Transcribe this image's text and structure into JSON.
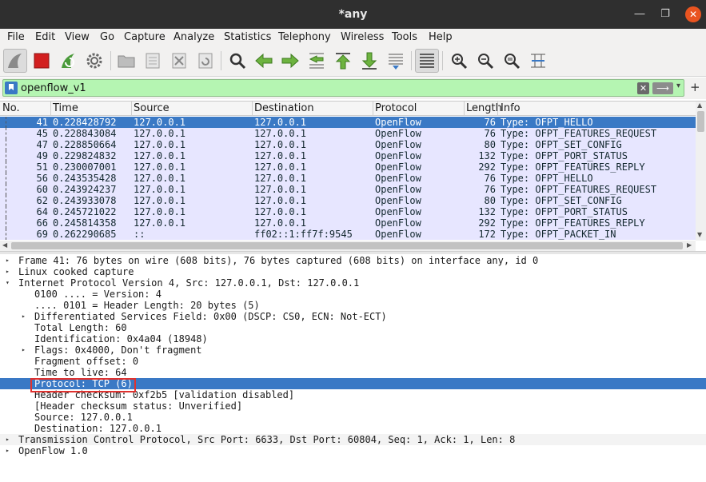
{
  "window": {
    "title": "*any"
  },
  "menu": [
    "File",
    "Edit",
    "View",
    "Go",
    "Capture",
    "Analyze",
    "Statistics",
    "Telephony",
    "Wireless",
    "Tools",
    "Help"
  ],
  "toolbar_icons": [
    "shark-fin-icon",
    "stop-icon",
    "restart-icon",
    "options-gear-icon",
    "open-folder-icon",
    "save-file-icon",
    "close-file-icon",
    "reload-file-icon",
    "find-icon",
    "back-arrow-icon",
    "forward-arrow-icon",
    "goto-packet-icon",
    "first-packet-icon",
    "last-packet-icon",
    "autoscroll-icon",
    "colorize-icon",
    "zoom-in-icon",
    "zoom-out-icon",
    "zoom-normal-icon",
    "resize-columns-icon"
  ],
  "filter": {
    "value": "openflow_v1",
    "clear": "✕",
    "apply": "⟶",
    "dropdown": "▾",
    "add": "+"
  },
  "packet_list": {
    "columns": [
      "No.",
      "Time",
      "Source",
      "Destination",
      "Protocol",
      "Length",
      "Info"
    ],
    "rows": [
      [
        "41",
        "0.228428792",
        "127.0.0.1",
        "127.0.0.1",
        "OpenFlow",
        "76",
        "Type: OFPT_HELLO"
      ],
      [
        "45",
        "0.228843084",
        "127.0.0.1",
        "127.0.0.1",
        "OpenFlow",
        "76",
        "Type: OFPT_FEATURES_REQUEST"
      ],
      [
        "47",
        "0.228850664",
        "127.0.0.1",
        "127.0.0.1",
        "OpenFlow",
        "80",
        "Type: OFPT_SET_CONFIG"
      ],
      [
        "49",
        "0.229824832",
        "127.0.0.1",
        "127.0.0.1",
        "OpenFlow",
        "132",
        "Type: OFPT_PORT_STATUS"
      ],
      [
        "51",
        "0.230007001",
        "127.0.0.1",
        "127.0.0.1",
        "OpenFlow",
        "292",
        "Type: OFPT_FEATURES_REPLY"
      ],
      [
        "56",
        "0.243535428",
        "127.0.0.1",
        "127.0.0.1",
        "OpenFlow",
        "76",
        "Type: OFPT_HELLO"
      ],
      [
        "60",
        "0.243924237",
        "127.0.0.1",
        "127.0.0.1",
        "OpenFlow",
        "76",
        "Type: OFPT_FEATURES_REQUEST"
      ],
      [
        "62",
        "0.243933078",
        "127.0.0.1",
        "127.0.0.1",
        "OpenFlow",
        "80",
        "Type: OFPT_SET_CONFIG"
      ],
      [
        "64",
        "0.245721022",
        "127.0.0.1",
        "127.0.0.1",
        "OpenFlow",
        "132",
        "Type: OFPT_PORT_STATUS"
      ],
      [
        "66",
        "0.245814358",
        "127.0.0.1",
        "127.0.0.1",
        "OpenFlow",
        "292",
        "Type: OFPT_FEATURES_REPLY"
      ],
      [
        "69",
        "0.262290685",
        "::",
        "ff02::1:ff7f:9545",
        "OpenFlow",
        "172",
        "Type: OFPT_PACKET_IN"
      ]
    ]
  },
  "details": [
    {
      "text": "Frame 41: 76 bytes on wire (608 bits), 76 bytes captured (608 bits) on interface any, id 0",
      "arrow": "▸"
    },
    {
      "text": "Linux cooked capture",
      "arrow": "▸"
    },
    {
      "text": "Internet Protocol Version 4, Src: 127.0.0.1, Dst: 127.0.0.1",
      "arrow": "▾"
    },
    {
      "text": "0100 .... = Version: 4",
      "arrow": ""
    },
    {
      "text": ".... 0101 = Header Length: 20 bytes (5)",
      "arrow": ""
    },
    {
      "text": "Differentiated Services Field: 0x00 (DSCP: CS0, ECN: Not-ECT)",
      "arrow": "▸"
    },
    {
      "text": "Total Length: 60",
      "arrow": ""
    },
    {
      "text": "Identification: 0x4a04 (18948)",
      "arrow": ""
    },
    {
      "text": "Flags: 0x4000, Don't fragment",
      "arrow": "▸"
    },
    {
      "text": "Fragment offset: 0",
      "arrow": ""
    },
    {
      "text": "Time to live: 64",
      "arrow": ""
    },
    {
      "text": "Protocol: TCP (6)",
      "arrow": ""
    },
    {
      "text": "Header checksum: 0xf2b5 [validation disabled]",
      "arrow": ""
    },
    {
      "text": "[Header checksum status: Unverified]",
      "arrow": ""
    },
    {
      "text": "Source: 127.0.0.1",
      "arrow": ""
    },
    {
      "text": "Destination: 127.0.0.1",
      "arrow": ""
    },
    {
      "text": "Transmission Control Protocol, Src Port: 6633, Dst Port: 60804, Seq: 1, Ack: 1, Len: 8",
      "arrow": "▸"
    },
    {
      "text": "OpenFlow 1.0",
      "arrow": "▸"
    }
  ],
  "colors": {
    "selected": "#3a79c5",
    "openflow_row": "#e7e6ff",
    "filter_ok": "#b5f5b2",
    "highlight_box": "#e0322f"
  }
}
